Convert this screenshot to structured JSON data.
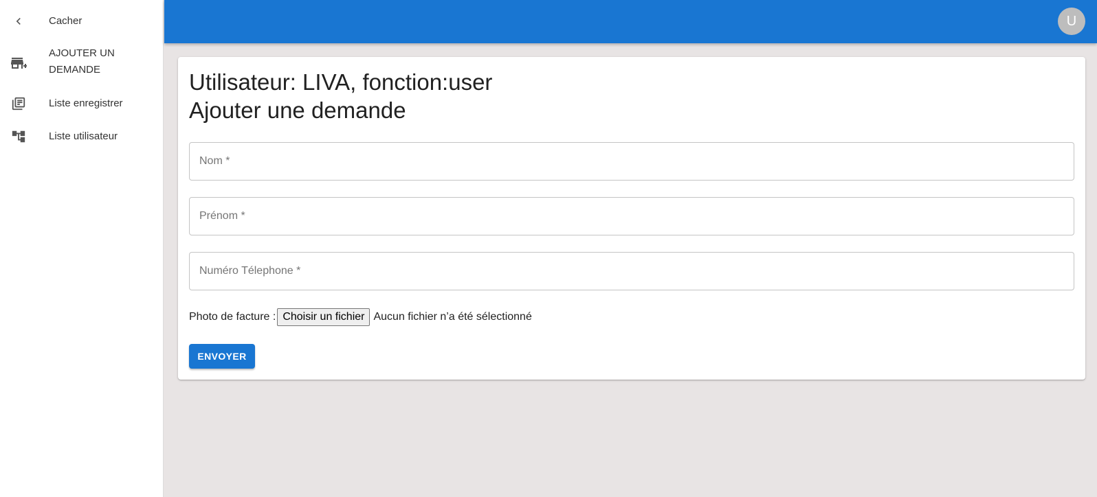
{
  "sidebar": {
    "items": [
      {
        "icon": "chevron-left-icon",
        "label": "Cacher"
      },
      {
        "icon": "add-store-icon",
        "label": "AJOUTER UN DEMANDE"
      },
      {
        "icon": "library-books-icon",
        "label": "Liste enregistrer"
      },
      {
        "icon": "account-tree-icon",
        "label": "Liste utilisateur"
      }
    ]
  },
  "topbar": {
    "avatar_letter": "U",
    "color": "#1976d2"
  },
  "form": {
    "title_line1": "Utilisateur: LIVA, fonction:user",
    "title_line2": "Ajouter une demande",
    "fields": {
      "nom_placeholder": "Nom *",
      "prenom_placeholder": "Prénom *",
      "telephone_placeholder": "Numéro Télephone *"
    },
    "file": {
      "label": "Photo de facture :",
      "button": "Choisir un fichier",
      "status": "Aucun fichier n’a été sélectionné"
    },
    "submit_label": "ENVOYER"
  }
}
